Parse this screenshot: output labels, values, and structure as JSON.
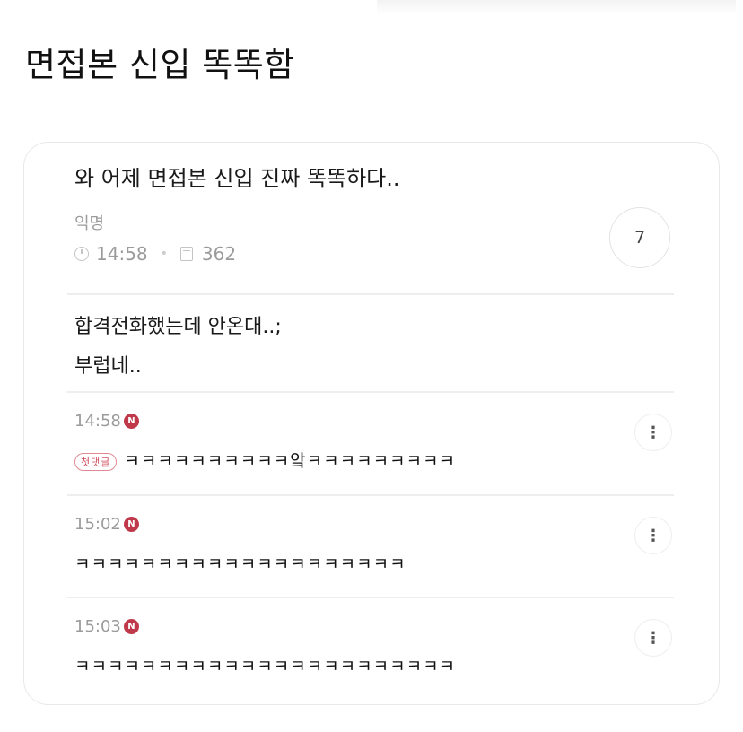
{
  "page_title": "면접본 신입 똑똑함",
  "post": {
    "title": "와 어제 면접본 신입 진짜 똑똑하다..",
    "author": "익명",
    "time": "14:58",
    "views": "362",
    "comment_count": "7",
    "body_line1": "합격전화했는데 안온대..;",
    "body_line2": "부럽네.."
  },
  "comments": [
    {
      "time": "14:58",
      "new_badge": "N",
      "first_badge": "첫댓글",
      "text": "ㅋㅋㅋㅋㅋㅋㅋㅋㅋㅋ앜ㅋㅋㅋㅋㅋㅋㅋㅋㅋ"
    },
    {
      "time": "15:02",
      "new_badge": "N",
      "text": "ㅋㅋㅋㅋㅋㅋㅋㅋㅋㅋㅋㅋㅋㅋㅋㅋㅋㅋㅋㅋ"
    },
    {
      "time": "15:03",
      "new_badge": "N",
      "text": "ㅋㅋㅋㅋㅋㅋㅋㅋㅋㅋㅋㅋㅋㅋㅋㅋㅋㅋㅋㅋㅋㅋㅋ"
    }
  ],
  "icons": {
    "clock": "clock-icon",
    "views": "document-icon",
    "more": "more-vertical-icon"
  },
  "colors": {
    "new_badge": "#c0394b",
    "muted_text": "#9b9b9b"
  }
}
